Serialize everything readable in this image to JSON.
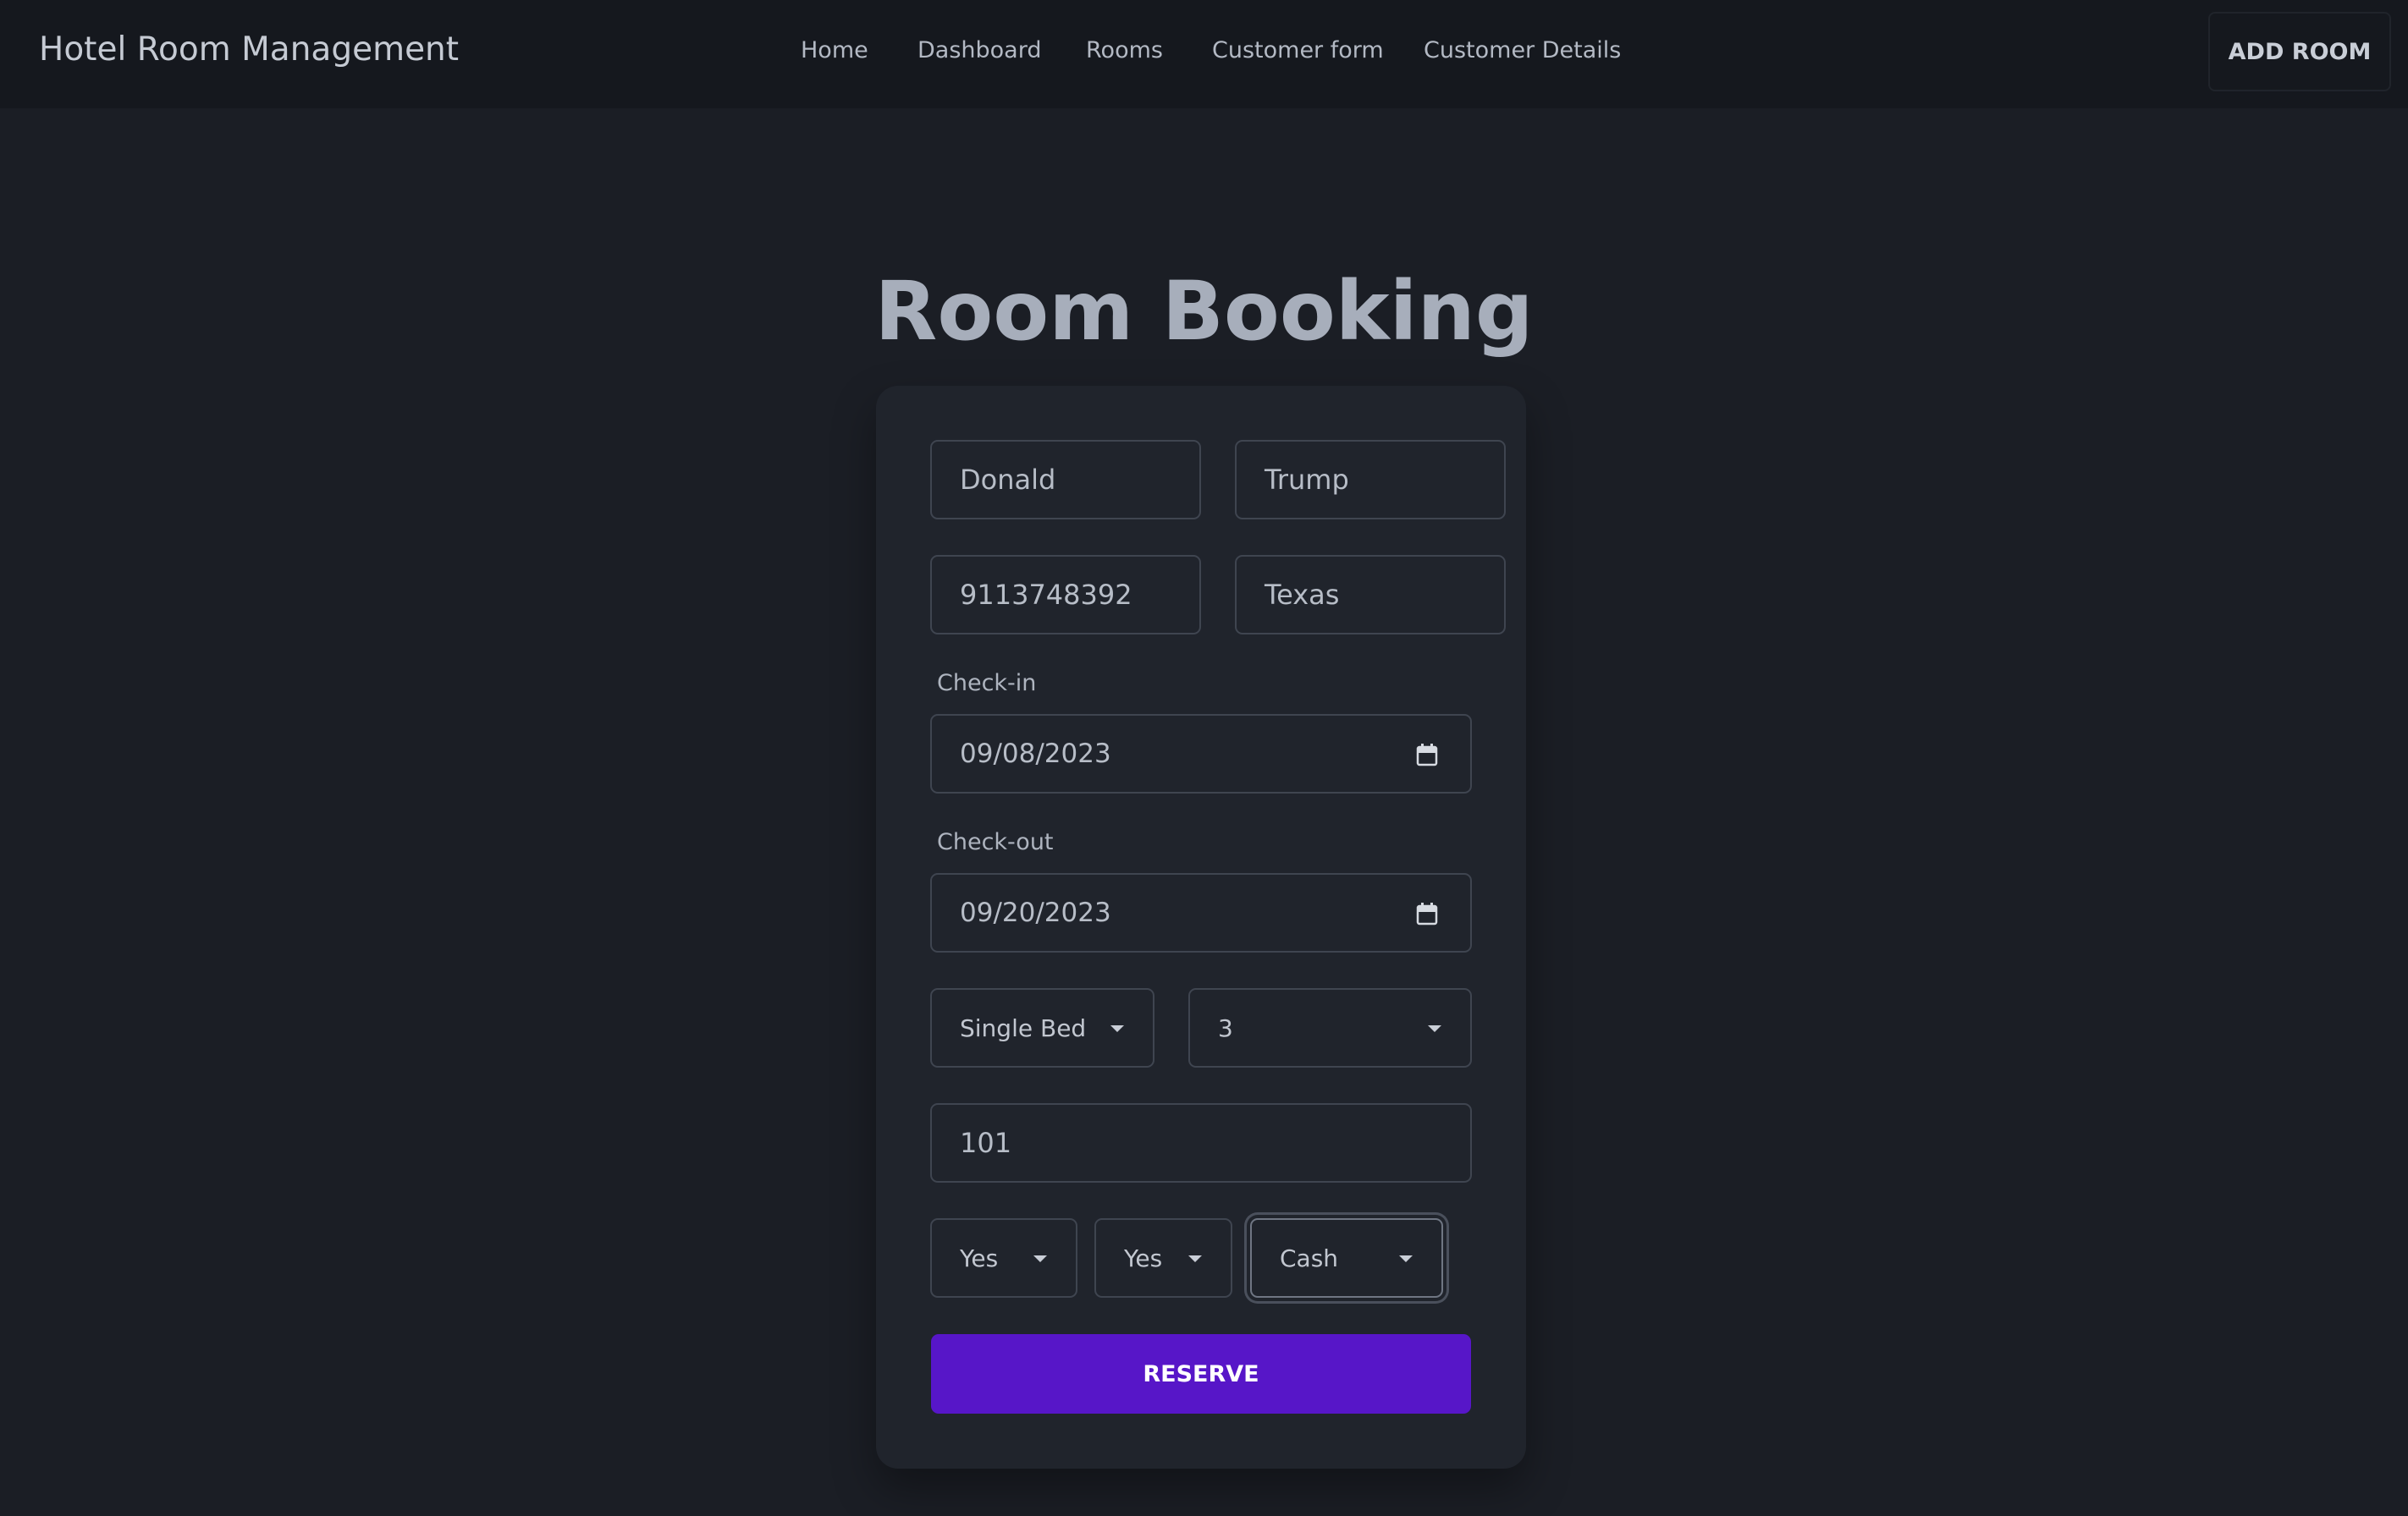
{
  "navbar": {
    "brand": "Hotel Room Management",
    "links": [
      {
        "label": "Home"
      },
      {
        "label": "Dashboard"
      },
      {
        "label": "Rooms"
      },
      {
        "label": "Customer form"
      },
      {
        "label": "Customer Details"
      }
    ],
    "add_room_label": "ADD ROOM"
  },
  "form": {
    "title": "Room Booking",
    "first_name": "Donald",
    "last_name": "Trump",
    "phone": "9113748392",
    "state": "Texas",
    "checkin_label": "Check-in",
    "checkin_value": "09/08/2023",
    "checkout_label": "Check-out",
    "checkout_value": "09/20/2023",
    "bed_type": "Single Bed",
    "guests": "3",
    "room_number": "101",
    "option_one": "Yes",
    "option_two": "Yes",
    "payment": "Cash",
    "reserve_label": "RESERVE"
  },
  "icons": {
    "calendar": "calendar-icon",
    "dropdown": "chevron-down-icon"
  },
  "colors": {
    "accent": "#5716c8",
    "background": "#1b1e25",
    "navbar": "#15181e",
    "card": "#20242c"
  }
}
